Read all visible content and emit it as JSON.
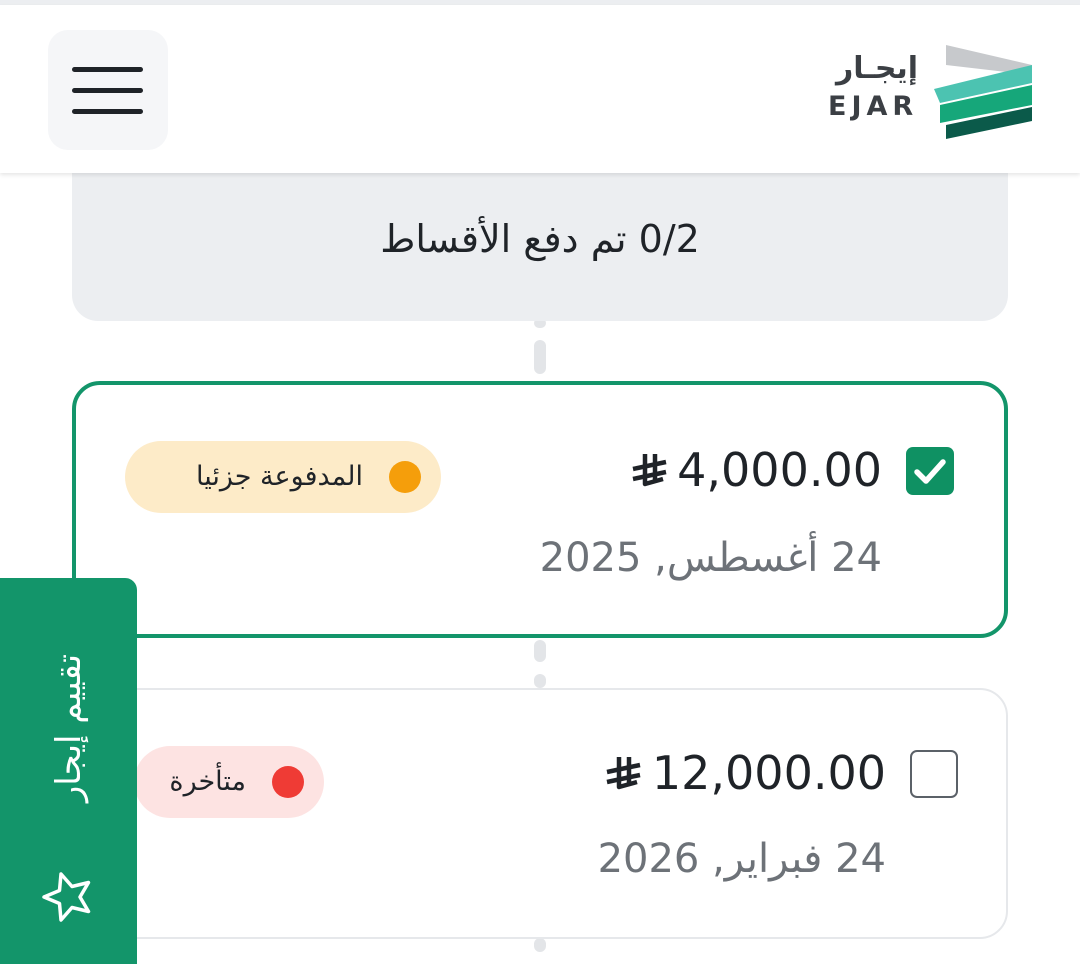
{
  "header": {
    "logo_ar": "إيجـار",
    "logo_en": "EJAR",
    "menu_icon": "hamburger-menu-icon",
    "logo_colors": [
      "#c7c9cc",
      "#4cc3b1",
      "#16a77a",
      "#0b5a4a"
    ]
  },
  "summary": {
    "text": "0/2 تم دفع الأقساط"
  },
  "installments": [
    {
      "amount": "4,000.00",
      "currency_icon": "saudi-riyal-icon",
      "date": "24 أغسطس, 2025",
      "status": "المدفوعة جزئيا",
      "status_color": "#f59e0b",
      "status_bg": "#fdebc8",
      "selected": true
    },
    {
      "amount": "12,000.00",
      "currency_icon": "saudi-riyal-icon",
      "date": "24 فبراير, 2026",
      "status": "متأخرة",
      "status_color": "#ef3b35",
      "status_bg": "#fde3e2",
      "selected": false
    }
  ],
  "feedback": {
    "label": "تقييم إيجار",
    "icon": "star-outline-icon"
  },
  "colors": {
    "accent": "#13956a",
    "text": "#1f2328",
    "muted": "#6d7278"
  }
}
